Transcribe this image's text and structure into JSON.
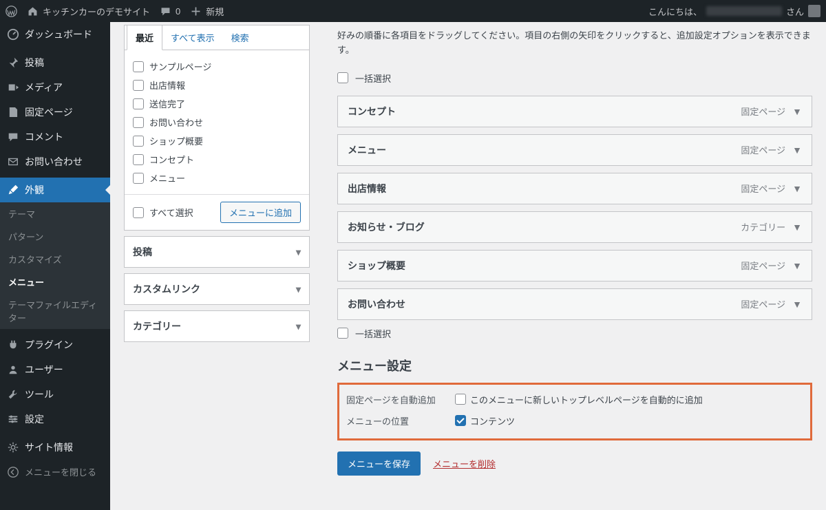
{
  "adminbar": {
    "site_name": "キッチンカーのデモサイト",
    "comments_count": "0",
    "new_label": "新規",
    "greeting": "こんにちは、",
    "greeting_suffix": "さん"
  },
  "sidebar": {
    "items": [
      {
        "label": "ダッシュボード",
        "icon": "dashboard"
      },
      {
        "label": "投稿",
        "icon": "pin"
      },
      {
        "label": "メディア",
        "icon": "media"
      },
      {
        "label": "固定ページ",
        "icon": "page"
      },
      {
        "label": "コメント",
        "icon": "comment"
      },
      {
        "label": "お問い合わせ",
        "icon": "mail"
      },
      {
        "label": "外観",
        "icon": "brush",
        "active": true
      },
      {
        "label": "プラグイン",
        "icon": "plug"
      },
      {
        "label": "ユーザー",
        "icon": "user"
      },
      {
        "label": "ツール",
        "icon": "tool"
      },
      {
        "label": "設定",
        "icon": "settings"
      },
      {
        "label": "サイト情報",
        "icon": "gear"
      }
    ],
    "subitems": [
      "テーマ",
      "パターン",
      "カスタマイズ",
      "メニュー",
      "テーマファイルエディター"
    ],
    "sub_current_index": 3,
    "collapse": "メニューを閉じる"
  },
  "left_panel": {
    "tabs": {
      "recent": "最近",
      "all": "すべて表示",
      "search": "検索"
    },
    "pages": [
      "サンプルページ",
      "出店情報",
      "送信完了",
      "お問い合わせ",
      "ショップ概要",
      "コンセプト",
      "メニュー"
    ],
    "select_all": "すべて選択",
    "add_button": "メニューに追加",
    "accordions": [
      "投稿",
      "カスタムリンク",
      "カテゴリー"
    ]
  },
  "right_panel": {
    "hint": "好みの順番に各項目をドラッグしてください。項目の右側の矢印をクリックすると、追加設定オプションを表示できます。",
    "bulk_select": "一括選択",
    "menu_items": [
      {
        "label": "コンセプト",
        "type": "固定ページ"
      },
      {
        "label": "メニュー",
        "type": "固定ページ"
      },
      {
        "label": "出店情報",
        "type": "固定ページ"
      },
      {
        "label": "お知らせ・ブログ",
        "type": "カテゴリー"
      },
      {
        "label": "ショップ概要",
        "type": "固定ページ"
      },
      {
        "label": "お問い合わせ",
        "type": "固定ページ"
      }
    ],
    "settings_heading": "メニュー設定",
    "auto_add": {
      "label": "固定ページを自動追加",
      "option": "このメニューに新しいトップレベルページを自動的に追加"
    },
    "location": {
      "label": "メニューの位置",
      "option": "コンテンツ",
      "checked": true
    },
    "save_button": "メニューを保存",
    "delete_link": "メニューを削除"
  }
}
